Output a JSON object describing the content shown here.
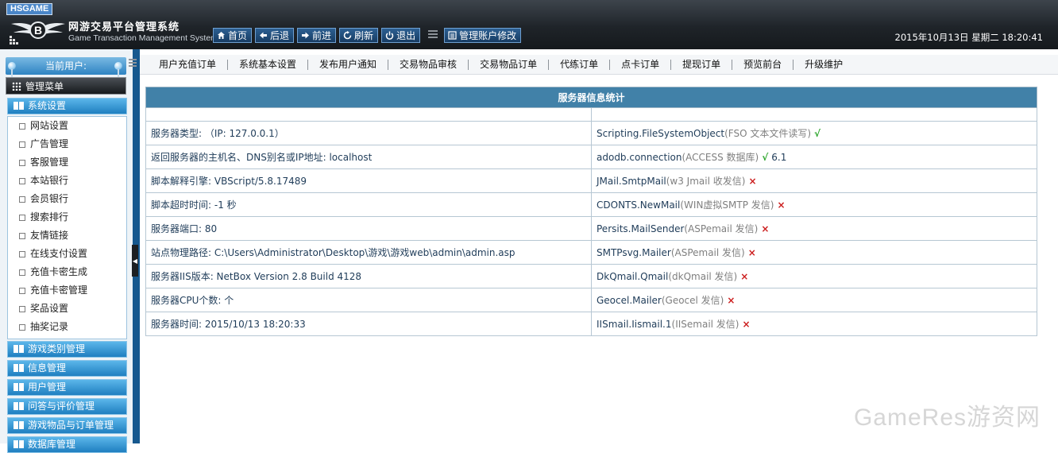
{
  "header": {
    "brand_tag": "HSGAME",
    "system_title": "网游交易平台管理系统",
    "system_subtitle": "Game Transaction Management System",
    "nav": [
      {
        "label": "首页",
        "icon": "home-icon"
      },
      {
        "label": "后退",
        "icon": "arrow-left-icon"
      },
      {
        "label": "前进",
        "icon": "arrow-right-icon"
      },
      {
        "label": "刷新",
        "icon": "refresh-icon"
      },
      {
        "label": "退出",
        "icon": "power-icon"
      }
    ],
    "account_button": {
      "label": "管理账户修改",
      "icon": "account-icon"
    },
    "datetime": "2015年10月13日 星期二 18:20:41"
  },
  "sidebar": {
    "current_user_label": "当前用户:",
    "menu_title": "管理菜单",
    "open_category": "系统设置",
    "items": [
      "网站设置",
      "广告管理",
      "客服管理",
      "本站银行",
      "会员银行",
      "搜索排行",
      "友情链接",
      "在线支付设置",
      "充值卡密生成",
      "充值卡密管理",
      "奖品设置",
      "抽奖记录"
    ],
    "categories": [
      "游戏类别管理",
      "信息管理",
      "用户管理",
      "问答与评价管理",
      "游戏物品与订单管理",
      "数据库管理"
    ]
  },
  "subnav": [
    "用户充值订单",
    "系统基本设置",
    "发布用户通知",
    "交易物品审核",
    "交易物品订单",
    "代练订单",
    "点卡订单",
    "提现订单",
    "预览前台",
    "升级维护"
  ],
  "server_info": {
    "title": "服务器信息统计",
    "rows": [
      {
        "left": "服务器类型: （IP: 127.0.0.1）",
        "component": "Scripting.FileSystemObject",
        "desc": "(FSO 文本文件读写)",
        "status": "ok",
        "version": ""
      },
      {
        "left": "返回服务器的主机名、DNS别名或IP地址: localhost",
        "component": "adodb.connection",
        "desc": "(ACCESS 数据库)",
        "status": "ok",
        "version": "6.1"
      },
      {
        "left": "脚本解释引擎: VBScript/5.8.17489",
        "component": "JMail.SmtpMail",
        "desc": "(w3 Jmail 收发信)",
        "status": "no",
        "version": ""
      },
      {
        "left": "脚本超时时间: -1 秒",
        "component": "CDONTS.NewMail",
        "desc": "(WIN虚拟SMTP 发信)",
        "status": "no",
        "version": ""
      },
      {
        "left": "服务器端口: 80",
        "component": "Persits.MailSender",
        "desc": "(ASPemail 发信)",
        "status": "no",
        "version": ""
      },
      {
        "left": "站点物理路径: C:\\Users\\Administrator\\Desktop\\游戏\\游戏web\\admin\\admin.asp",
        "component": "SMTPsvg.Mailer",
        "desc": "(ASPemail 发信)",
        "status": "no",
        "version": ""
      },
      {
        "left": "服务器IIS版本: NetBox Version 2.8 Build 4128",
        "component": "DkQmail.Qmail",
        "desc": "(dkQmail 发信)",
        "status": "no",
        "version": ""
      },
      {
        "left": "服务器CPU个数: 个",
        "component": "Geocel.Mailer",
        "desc": "(Geocel 发信)",
        "status": "no",
        "version": ""
      },
      {
        "left": "服务器时间: 2015/10/13 18:20:33",
        "component": "IISmail.Iismail.1",
        "desc": "(IISemail 发信)",
        "status": "no",
        "version": ""
      }
    ],
    "ok_mark": "√",
    "no_mark": "×"
  },
  "watermark": "GameRes游资网"
}
